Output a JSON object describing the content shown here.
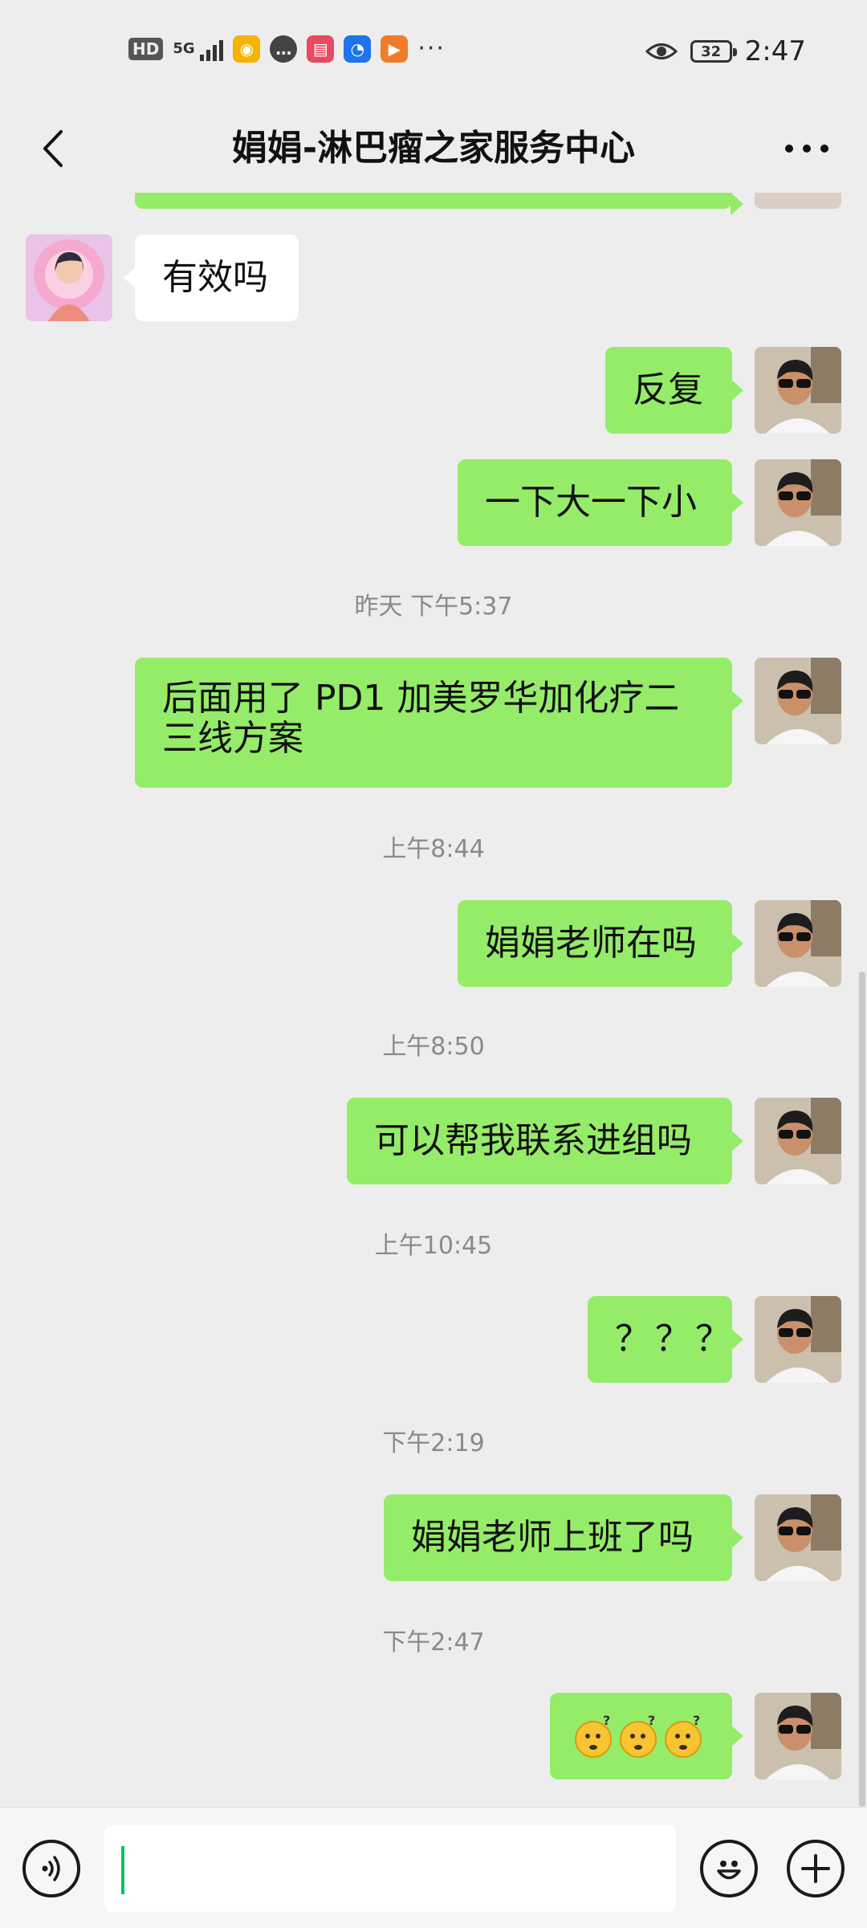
{
  "status_bar": {
    "hd": "HD",
    "network": "5G",
    "battery": "32",
    "time": "2:47",
    "overflow": "···"
  },
  "header": {
    "title": "娟娟-淋巴瘤之家服务中心"
  },
  "messages": [
    {
      "type": "text",
      "from": "them",
      "text": "有效吗"
    },
    {
      "type": "text",
      "from": "me",
      "text": "反复"
    },
    {
      "type": "text",
      "from": "me",
      "text": "一下大一下小"
    },
    {
      "type": "time",
      "text": "昨天 下午5:37"
    },
    {
      "type": "text",
      "from": "me",
      "text": "后面用了 PD1 加美罗华加化疗二三线方案"
    },
    {
      "type": "time",
      "text": "上午8:44"
    },
    {
      "type": "text",
      "from": "me",
      "text": "娟娟老师在吗"
    },
    {
      "type": "time",
      "text": "上午8:50"
    },
    {
      "type": "text",
      "from": "me",
      "text": "可以帮我联系进组吗"
    },
    {
      "type": "time",
      "text": "上午10:45"
    },
    {
      "type": "text",
      "from": "me",
      "text": "？？？"
    },
    {
      "type": "time",
      "text": "下午2:19"
    },
    {
      "type": "text",
      "from": "me",
      "text": "娟娟老师上班了吗"
    },
    {
      "type": "time",
      "text": "下午2:47"
    },
    {
      "type": "emoji",
      "from": "me",
      "text": "🫤🫤🫤",
      "icon": "confused-face-emoji"
    }
  ],
  "input": {
    "value": "",
    "placeholder": ""
  },
  "colors": {
    "my_bubble": "#95ec69",
    "their_bubble": "#ffffff",
    "background": "#ededed",
    "caret": "#07c160"
  },
  "icons": [
    "back-arrow-icon",
    "more-dots-icon",
    "voice-icon",
    "emoji-face-icon",
    "plus-icon"
  ]
}
